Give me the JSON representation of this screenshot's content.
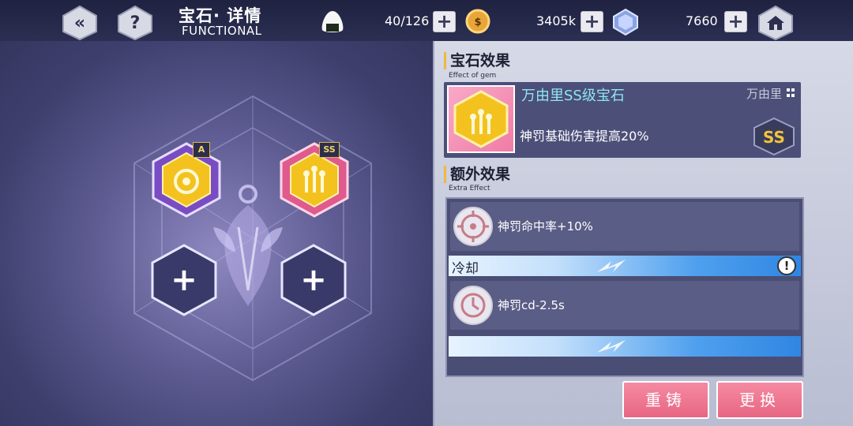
{
  "colors": {
    "accent": "#f0b840",
    "button": "#e86683",
    "teal_text": "#8ee6f0"
  },
  "topbar": {
    "back_icon": "back-arrow-icon",
    "help_icon": "question-icon",
    "title": "宝石· 详情",
    "subtitle": "FUNCTIONAL",
    "stamina_icon": "onigiri-icon",
    "stamina": "40/126",
    "coin_icon": "gold-coin-icon",
    "coins": "3405k",
    "crystal_icon": "crystal-icon",
    "crystals": "7660",
    "home_icon": "home-icon"
  },
  "gem_slots": [
    {
      "rank": "A",
      "state": "filled",
      "icon": "gem-a-icon"
    },
    {
      "rank": "SS",
      "state": "filled",
      "icon": "gem-ss-icon",
      "selected": true
    },
    {
      "state": "empty",
      "icon": "plus-icon"
    },
    {
      "state": "empty",
      "icon": "plus-icon"
    }
  ],
  "effect": {
    "title": "宝石效果",
    "subtitle": "Effect of gem",
    "gem_name": "万由里SS级宝石",
    "owner": "万由里",
    "description": "神罚基础伤害提高20%",
    "rank_badge_icon": "ss-rank-icon"
  },
  "extra": {
    "title": "额外效果",
    "subtitle": "Extra Effect",
    "rows": [
      {
        "icon": "crosshair-icon",
        "text": "神罚命中率+10%"
      },
      {
        "icon": "clock-icon",
        "text": "神罚cd-2.5s"
      }
    ],
    "cooldown_label": "冷却",
    "warning_icon": "exclamation-icon"
  },
  "buttons": {
    "recast": "重铸",
    "replace": "更换"
  }
}
